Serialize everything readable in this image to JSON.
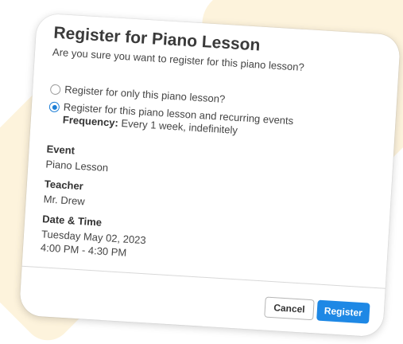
{
  "dialog": {
    "title": "Register for Piano Lesson",
    "subtitle": "Are you sure you want to register for this piano lesson?"
  },
  "options": [
    {
      "label": "Register for only this piano lesson?",
      "selected": false
    },
    {
      "label": "Register for this piano lesson and recurring events",
      "selected": true
    }
  ],
  "frequency": {
    "label": "Frequency:",
    "value": "Every 1 week, indefinitely"
  },
  "details": {
    "event_label": "Event",
    "event_value": "Piano Lesson",
    "teacher_label": "Teacher",
    "teacher_value": "Mr. Drew",
    "datetime_label": "Date & Time",
    "date_value": "Tuesday May 02, 2023",
    "time_value": "4:00 PM - 4:30 PM"
  },
  "actions": {
    "cancel_label": "Cancel",
    "register_label": "Register"
  },
  "colors": {
    "accent": "#1e88e5",
    "background_shape": "#fdf3dc"
  }
}
